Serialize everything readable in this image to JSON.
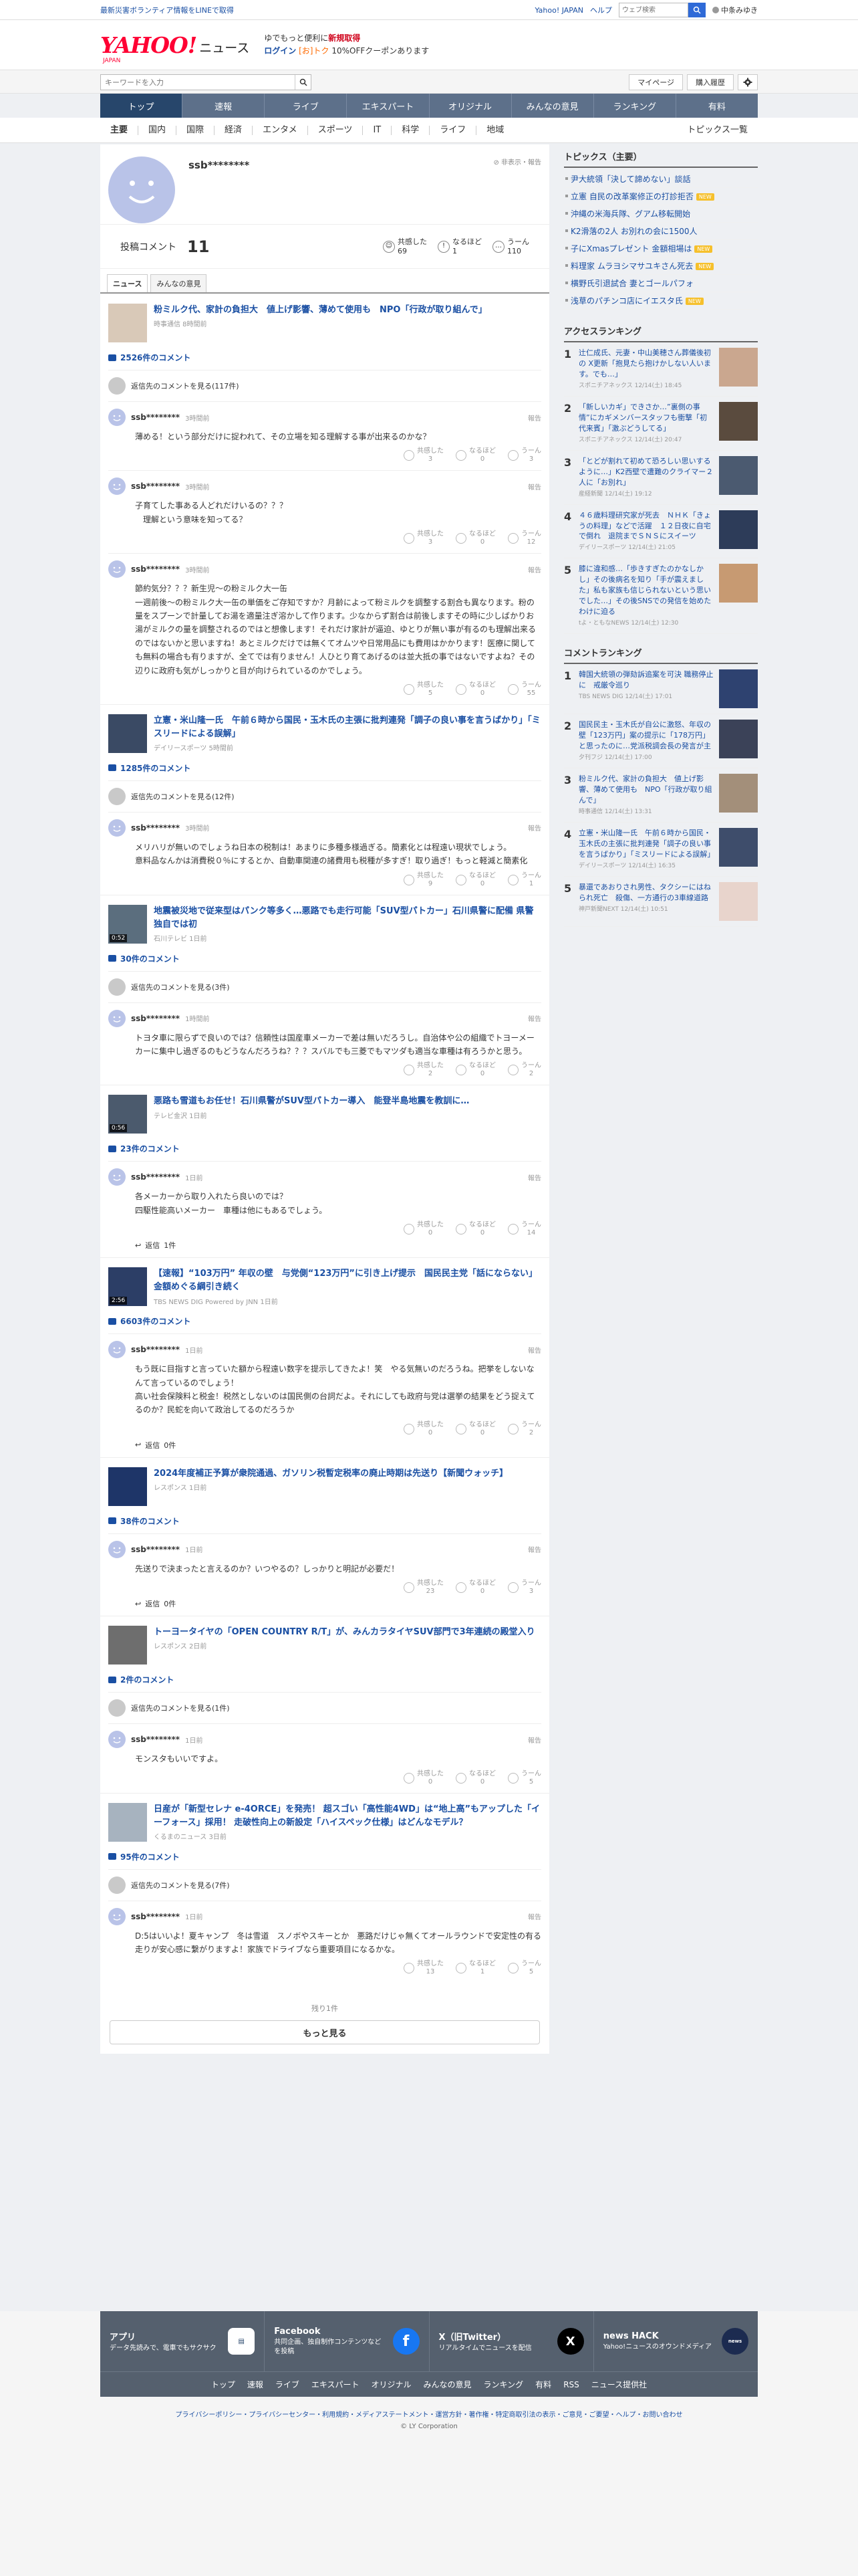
{
  "topbar": {
    "left_link": "最新災害ボランティア情報をLINEで取得",
    "yahoo_japan": "Yahoo! JAPAN",
    "help": "ヘルプ",
    "search_placeholder": "ウェブ検索",
    "user_name": "中条みゆき"
  },
  "header": {
    "logo_main": "YAHOO!",
    "logo_news": "ニュース",
    "logo_sub": "JAPAN",
    "promo_line1_pre": "ゆでもっと便利に",
    "promo_line1_em": "新規取得",
    "promo_line2_link": "ログイン",
    "promo_line2_badge": "[お]トク",
    "promo_line2_text": "10%OFFクーポンあります"
  },
  "search": {
    "placeholder": "キーワードを入力",
    "mypage": "マイページ",
    "history": "購入履歴"
  },
  "nav": {
    "items": [
      "トップ",
      "速報",
      "ライブ",
      "エキスパート",
      "オリジナル",
      "みんなの意見",
      "ランキング",
      "有料"
    ]
  },
  "subnav": {
    "items": [
      "主要",
      "国内",
      "国際",
      "経済",
      "エンタメ",
      "スポーツ",
      "IT",
      "科学",
      "ライフ",
      "地域"
    ],
    "topics_list": "トピックス一覧"
  },
  "profile": {
    "username": "ssb********",
    "hide": "非表示・報告",
    "comments_label": "投稿コメント",
    "comments_count": "11",
    "kyokan_label": "共感した",
    "kyokan_count": "69",
    "naruhodo_label": "なるほど",
    "naruhodo_count": "1",
    "uun_label": "うーん",
    "uun_count": "110",
    "tab_news": "ニュース",
    "tab_minna": "みんなの意見"
  },
  "labels": {
    "report": "報告",
    "kyokan": "共感した",
    "naruhodo": "なるほど",
    "uun": "うーん",
    "reply_suffix": "返信"
  },
  "articles": [
    {
      "title": "粉ミルク代、家計の負担大　値上げ影響、薄めて使用も　NPO「行政が取り組んで」",
      "source": "時事通信 8時間前",
      "count": "2526件のコメント",
      "showmore": "返信先のコメントを見る(117件)",
      "comments": [
        {
          "user": "ssb********",
          "time": "3時間前",
          "text": "薄める！という部分だけに捉われて、その立場を知る理解する事が出来るのかな？",
          "k": "3",
          "n": "0",
          "u": "3"
        },
        {
          "user": "ssb********",
          "time": "3時間前",
          "text": "子育てした事ある人どれだけいるの？？？\n　理解という意味を知ってる？",
          "k": "3",
          "n": "0",
          "u": "12"
        },
        {
          "user": "ssb********",
          "time": "3時間前",
          "text": "節約気分？？？新生児～の粉ミルク大一缶\n一週前後～の粉ミルク大一缶の単価をご存知ですか？月齢によって粉ミルクを調整する割合も異なります。粉の量をスプーンで計量してお湯を適量注ぎ溶かして作ります。少なからず割合は前後しますその時に少しばかりお湯がミルクの量を調整されるのではと想像します！それだけ家計が逼迫、ゆとりが無い事が有るのも理解出来るのではないかと思いますね！あとミルクだけでは無くてオムツや日常用品にも費用はかかります！医療に関しても無料の場合も有りますが、全てでは有りません！人ひとり育てあげるのは並大抵の事ではないですよね？その辺りに政府も気がしっかりと目が向けられているのかでしょう。",
          "k": "5",
          "n": "0",
          "u": "55"
        }
      ]
    },
    {
      "title": "立憲・米山隆一氏　午前６時から国民・玉木氏の主張に批判連発「調子の良い事を言うばかり」「ミスリードによる誤解」",
      "source": "デイリースポーツ 5時間前",
      "count": "1285件のコメント",
      "showmore": "返信先のコメントを見る(12件)",
      "comments": [
        {
          "user": "ssb********",
          "time": "3時間前",
          "text": "メリハリが無いのでしょうね日本の税制は！あまりに多種多様過ぎる。簡素化とは程遠い現状でしょう。\n意料品なんかは消費税０％にするとか、自動車関連の諸費用も税種が多すぎ！取り過ぎ！もっと軽減と簡素化",
          "k": "9",
          "n": "0",
          "u": "1"
        }
      ]
    },
    {
      "title": "地震被災地で従来型はパンク等多く…悪路でも走行可能「SUV型パトカー」石川県警に配備 県警独自では初",
      "source": "石川テレビ 1日前",
      "dur": "0:52",
      "count": "30件のコメント",
      "showmore": "返信先のコメントを見る(3件)",
      "comments": [
        {
          "user": "ssb********",
          "time": "1時間前",
          "text": "トヨタ車に限らずで良いのでは？信頼性は国産車メーカーで差は無いだろうし。自治体や公の組織でトヨーメーカーに集中し過ぎるのもどうなんだろうね？？？スバルでも三菱でもマツダも適当な車種は有ろうかと思う。",
          "k": "2",
          "n": "0",
          "u": "2"
        }
      ]
    },
    {
      "title": "悪路も雪道もお任せ！石川県警がSUV型パトカー導入　能登半島地震を教訓に…",
      "source": "テレビ金沢 1日前",
      "dur": "0:56",
      "count": "23件のコメント",
      "comments": [
        {
          "user": "ssb********",
          "time": "1日前",
          "text": "各メーカーから取り入れたら良いのでは？\n四駆性能高いメーカー　車種は他にもあるでしょう。",
          "k": "0",
          "n": "0",
          "u": "14",
          "reply": "1件"
        }
      ]
    },
    {
      "title": "【速報】“103万円” 年収の壁　与党側“123万円”に引き上げ提示　国民民主党「話にならない」金額めぐる綱引き続く",
      "source": "TBS NEWS DIG Powered by JNN 1日前",
      "dur": "2:56",
      "count": "6603件のコメント",
      "comments": [
        {
          "user": "ssb********",
          "time": "1日前",
          "text": "もう既に目指すと言っていた額から程遠い数字を提示してきたよ！笑　やる気無いのだろうね。把挙をしないなんて言っているのでしょう！\n高い社会保険料と税金！税然としないのは国民側の台詞だよ。それにしても政府与党は選挙の結果をどう捉えてるのか？民蛇を向いて政治してるのだろうか",
          "k": "0",
          "n": "0",
          "u": "2",
          "reply": "0件"
        }
      ]
    },
    {
      "title": "2024年度補正予算が衆院通過、ガソリン税暫定税率の廃止時期は先送り【新聞ウォッチ】",
      "source": "レスポンス 1日前",
      "count": "38件のコメント",
      "comments": [
        {
          "user": "ssb********",
          "time": "1日前",
          "text": "先送りで決まったと言えるのか？いつやるの？しっかりと明記が必要だ！",
          "k": "23",
          "n": "0",
          "u": "3",
          "reply": "0件"
        }
      ]
    },
    {
      "title": "トーヨータイヤの「OPEN COUNTRY R/T」が、みんカラタイヤSUV部門で3年連続の殿堂入り",
      "source": "レスポンス 2日前",
      "count": "2件のコメント",
      "showmore": "返信先のコメントを見る(1件)",
      "comments": [
        {
          "user": "ssb********",
          "time": "1日前",
          "text": "モンスタもいいですよ。",
          "k": "0",
          "n": "0",
          "u": "5"
        }
      ]
    },
    {
      "title": "日産が「新型セレナ e-4ORCE」を発売！ 超スゴい「高性能4WD」は“地上高”もアップした「イーフォース」採用！ 走破性向上の新設定「ハイスペック仕様」はどんなモデル？",
      "source": "くるまのニュース 3日前",
      "count": "95件のコメント",
      "showmore": "返信先のコメントを見る(7件)",
      "comments": [
        {
          "user": "ssb********",
          "time": "1日前",
          "text": "D:5はいいよ！夏キャンプ　冬は雪道　スノボやスキーとか　悪路だけじゃ無くてオールラウンドで安定性の有る走りが安心感に繋がりますよ！家族でドライブなら重要項目になるかな。",
          "k": "13",
          "n": "1",
          "u": "5"
        }
      ]
    }
  ],
  "more": {
    "remaining": "残り1件",
    "button": "もっと見る"
  },
  "topics": {
    "heading": "トピックス（主要）",
    "new_label": "NEW",
    "items": [
      {
        "text": "尹大統領「決して諦めない」談話",
        "new": false
      },
      {
        "text": "立憲 自民の改革案修正の打診拒否",
        "new": true
      },
      {
        "text": "沖縄の米海兵隊、グアム移転開始",
        "new": false
      },
      {
        "text": "K2滑落の2人 お別れの会に1500人",
        "new": false
      },
      {
        "text": "子にXmasプレゼント 金額相場は",
        "new": true
      },
      {
        "text": "料理家 ムラヨシマサユキさん死去",
        "new": true
      },
      {
        "text": "横野氏引退試合 妻とゴールパフォ",
        "new": false
      },
      {
        "text": "浅草のパチンコ店にイエスタ氏",
        "new": true
      }
    ]
  },
  "access": {
    "heading": "アクセスランキング",
    "items": [
      {
        "no": "1",
        "text": "辻仁成氏、元妻・中山美穂さん葬儀後初の X更新「抱見たら抱けかしない人います。でも…」",
        "src": "スポニチアネックス 12/14(土) 18:45"
      },
      {
        "no": "2",
        "text": "「新しいカギ」できさか…”裏側の事情”にカギメンバースタッフも衝撃「初代来賓」「激ぶどうしてる」",
        "src": "スポニチアネックス 12/14(土) 20:47"
      },
      {
        "no": "3",
        "text": "「とどが割れて初めて恐ろしい思いするように…」K2西壁で遭難のクライマー２人に「お別れ」",
        "src": "産経新聞 12/14(土) 19:12"
      },
      {
        "no": "4",
        "text": "４６歳料理研究家が死去　ＮＨＫ「きょうの料理」などで活躍　１２日夜に自宅で倒れ　退院までＳＮＳにスイーツ",
        "src": "デイリースポーツ 12/14(土) 21:05"
      },
      {
        "no": "5",
        "text": "膝に違和感…「歩きすぎたのかなしかし」その後病名を知り「手が震えました」私も家族も信じられないという思いでした…」その後SNSでの発信を始めたわけに迫る",
        "src": "tよ・ともなNEWS 12/14(土) 12:30"
      }
    ]
  },
  "commentranks": {
    "heading": "コメントランキング",
    "items": [
      {
        "no": "1",
        "text": "韓国大統領の弾劾訴追案を可決 職務停止に　戒厳令巡り",
        "src": "TBS NEWS DIG 12/14(土) 17:01"
      },
      {
        "no": "2",
        "text": "国民民主・玉木氏が自公に激怒、年収の壁「123万円」案の提示に「178万円」と思ったのに…党派税調会長の発言が主",
        "src": "夕刊フジ 12/14(土) 17:00"
      },
      {
        "no": "3",
        "text": "粉ミルク代、家計の負担大　値上げ影響、薄めて使用も　NPO「行政が取り組んで」",
        "src": "時事通信 12/14(土) 13:31"
      },
      {
        "no": "4",
        "text": "立憲・米山隆一氏　午前６時から国民・玉木氏の主張に批判連発「調子の良い事を言うばかり」「ミスリードによる誤解」",
        "src": "デイリースポーツ 12/14(土) 16:35"
      },
      {
        "no": "5",
        "text": "暴還であおりされ男性、タクシーにはねられ死亡　殺傷、一方通行の3車線道路",
        "src": "神戸新聞NEXT 12/14(土) 10:51"
      }
    ]
  },
  "footer": {
    "apps": [
      {
        "title": "アプリ",
        "desc": "データ先読みで、電車でもサクサク"
      },
      {
        "title": "Facebook",
        "desc": "共同企画、独自制作コンテンツなどを投稿"
      },
      {
        "title": "X（旧Twitter）",
        "desc": "リアルタイムでニュースを配信"
      },
      {
        "title": "news HACK",
        "desc": "Yahoo!ニュースのオウンドメディア"
      }
    ],
    "nav": [
      "トップ",
      "速報",
      "ライブ",
      "エキスパート",
      "オリジナル",
      "みんなの意見",
      "ランキング",
      "有料",
      "RSS",
      "ニュース提供社"
    ],
    "links": "プライバシーポリシー・プライバシーセンター・利用規約・メディアステートメント・運営方針・著作権・特定商取引法の表示・ご意見・ご要望・ヘルプ・お問い合わせ",
    "copyright": "© LY Corporation"
  }
}
